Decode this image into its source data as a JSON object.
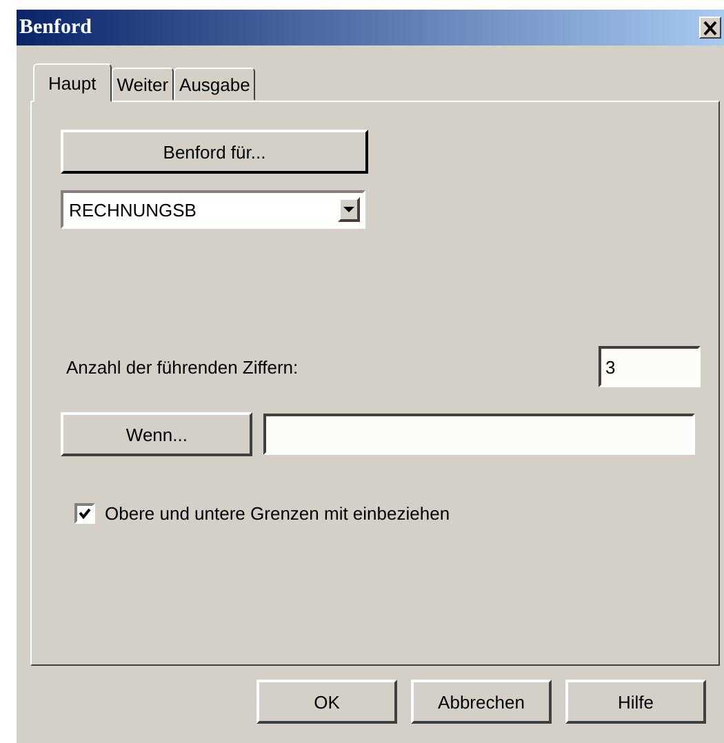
{
  "window": {
    "title": "Benford"
  },
  "tabs": [
    {
      "label": "Haupt",
      "selected": true
    },
    {
      "label": "Weiter",
      "selected": false
    },
    {
      "label": "Ausgabe",
      "selected": false
    }
  ],
  "field_button": {
    "label": "Benford für..."
  },
  "field_dropdown": {
    "value": "RECHNUNGSB"
  },
  "digits": {
    "label": "Anzahl der führenden Ziffern:",
    "value": "3"
  },
  "condition": {
    "button": "Wenn..."
  },
  "limits_checkbox": {
    "label": "Obere und untere Grenzen mit einbeziehen",
    "checked": true
  },
  "buttons": [
    "OK",
    "Abbrechen",
    "Hilfe"
  ]
}
